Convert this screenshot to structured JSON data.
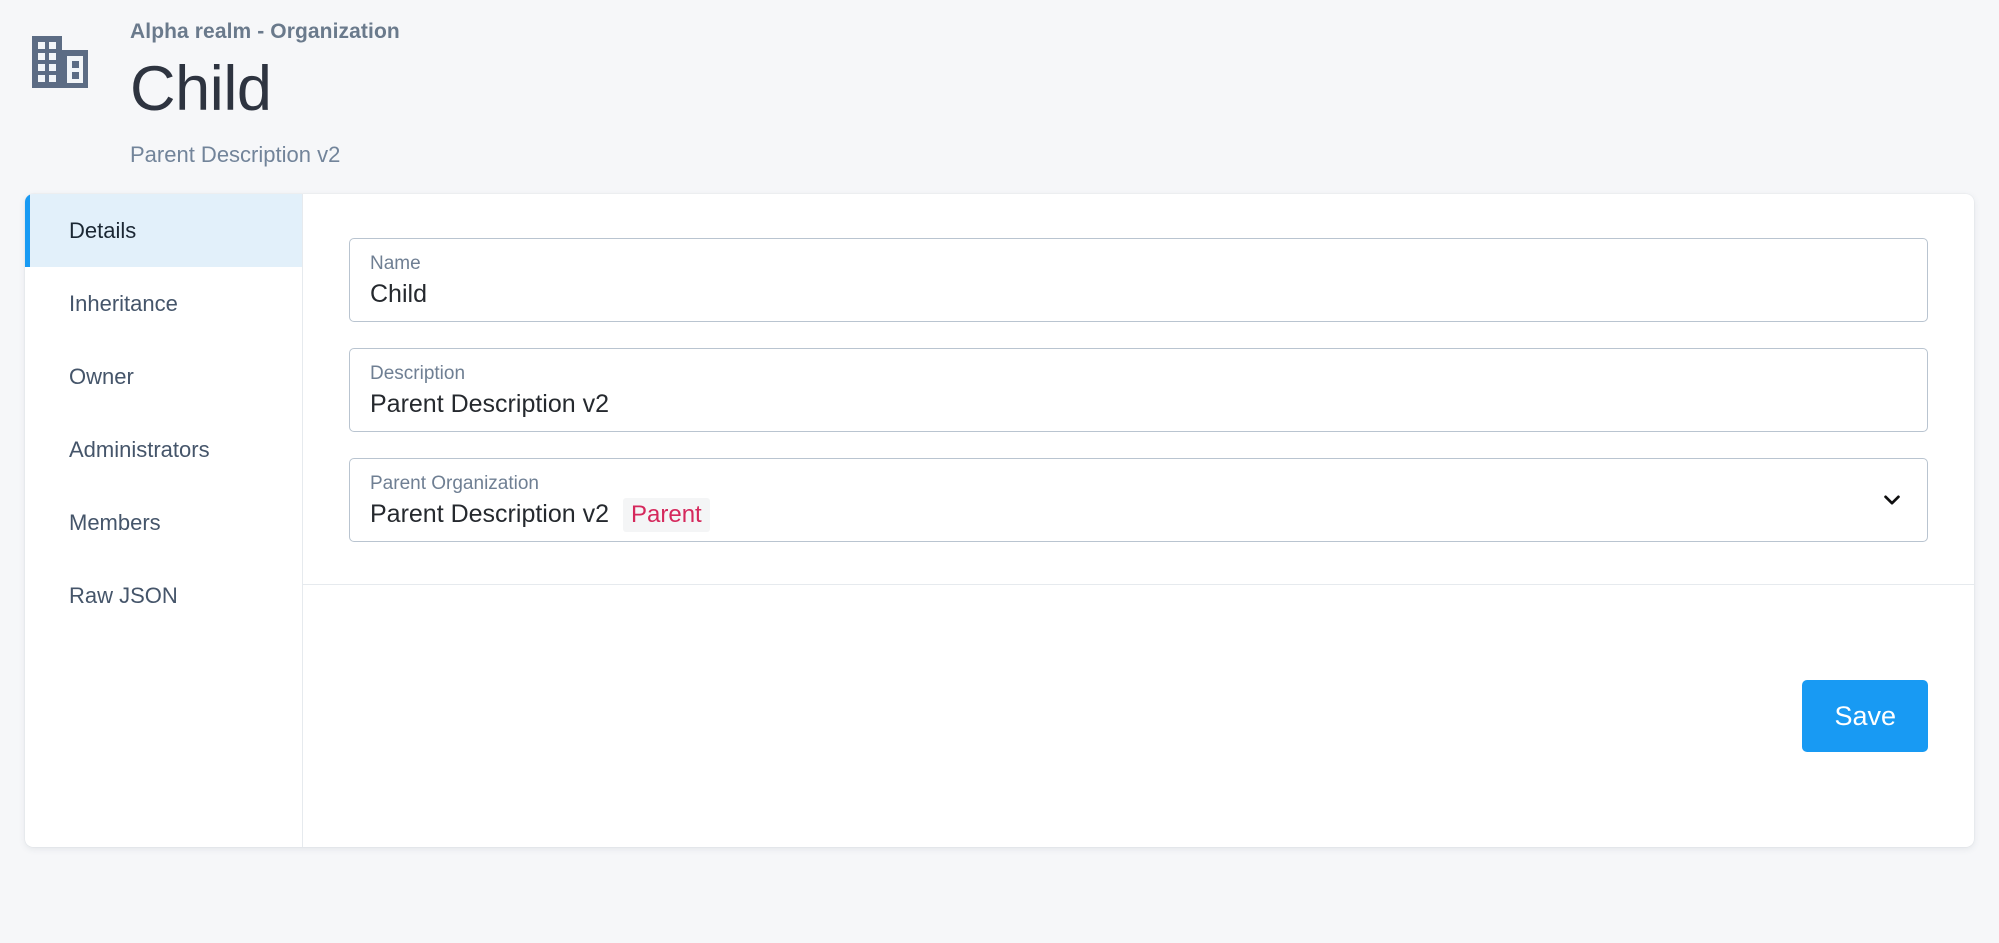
{
  "header": {
    "icon": "organization-building-icon",
    "breadcrumb": "Alpha realm - Organization",
    "title": "Child",
    "subtitle": "Parent Description v2"
  },
  "tabs": [
    {
      "label": "Details",
      "active": true
    },
    {
      "label": "Inheritance",
      "active": false
    },
    {
      "label": "Owner",
      "active": false
    },
    {
      "label": "Administrators",
      "active": false
    },
    {
      "label": "Members",
      "active": false
    },
    {
      "label": "Raw JSON",
      "active": false
    }
  ],
  "form": {
    "name": {
      "label": "Name",
      "value": "Child"
    },
    "description": {
      "label": "Description",
      "value": "Parent Description v2"
    },
    "parent_organization": {
      "label": "Parent Organization",
      "value": "Parent Description v2",
      "badge": "Parent",
      "chevron": "chevron-down-icon"
    }
  },
  "footer": {
    "save_label": "Save"
  },
  "colors": {
    "accent": "#189af3",
    "badge_text": "#d5285c",
    "active_tab_bg": "#e2f0fa",
    "page_bg": "#f6f7f9",
    "icon": "#5c6c84"
  }
}
